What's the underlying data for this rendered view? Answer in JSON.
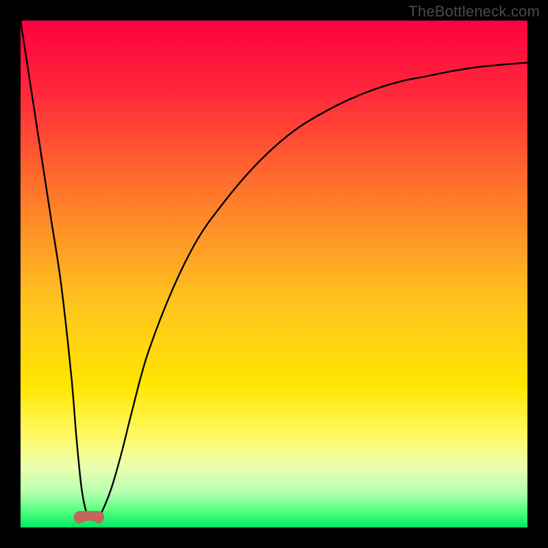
{
  "watermark": "TheBottleneck.com",
  "chart_data": {
    "type": "line",
    "title": "",
    "xlabel": "",
    "ylabel": "",
    "xlim": [
      0,
      100
    ],
    "ylim": [
      0,
      100
    ],
    "grid": false,
    "legend": false,
    "background": {
      "type": "vertical-gradient",
      "stops": [
        {
          "pos": 0.0,
          "color": "#ff0040"
        },
        {
          "pos": 0.15,
          "color": "#ff2b3a"
        },
        {
          "pos": 0.35,
          "color": "#ff7a2a"
        },
        {
          "pos": 0.55,
          "color": "#ffc21f"
        },
        {
          "pos": 0.72,
          "color": "#ffe600"
        },
        {
          "pos": 0.82,
          "color": "#fff966"
        },
        {
          "pos": 0.88,
          "color": "#eaffb0"
        },
        {
          "pos": 0.93,
          "color": "#b7ffb0"
        },
        {
          "pos": 0.97,
          "color": "#4dff7a"
        },
        {
          "pos": 1.0,
          "color": "#00e765"
        }
      ]
    },
    "series": [
      {
        "name": "bottleneck-curve",
        "color": "#000000",
        "x": [
          0,
          2,
          4,
          6,
          8,
          10,
          11,
          12,
          13,
          14,
          15,
          16,
          18,
          20,
          22,
          25,
          30,
          35,
          40,
          45,
          50,
          55,
          60,
          65,
          70,
          75,
          80,
          85,
          90,
          95,
          100
        ],
        "y": [
          100,
          87,
          74,
          61,
          48,
          30,
          18,
          8,
          3,
          2,
          2,
          3,
          8,
          15,
          23,
          34,
          47,
          57,
          64,
          70,
          75,
          79,
          82,
          84.5,
          86.5,
          88,
          89,
          90,
          90.8,
          91.3,
          91.7
        ]
      }
    ],
    "marker": {
      "name": "sweet-spot-marker",
      "color": "#c1675c",
      "cx": 13.5,
      "cy": 2,
      "shape": "capsule",
      "width": 6,
      "height": 2.5
    }
  }
}
